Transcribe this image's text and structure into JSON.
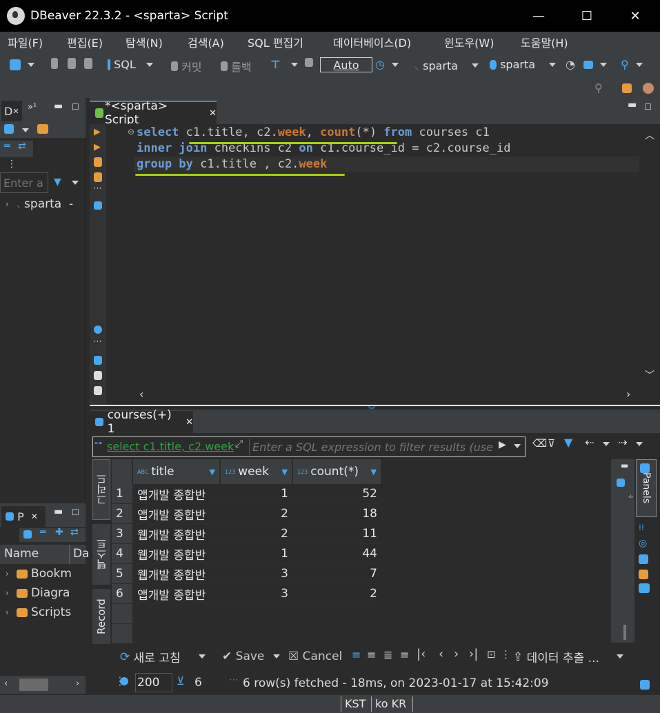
{
  "window": {
    "title": "DBeaver 22.3.2 - <sparta> Script",
    "minimize": "—",
    "maximize": "☐",
    "close": "✕"
  },
  "menu": [
    "파일(F)",
    "편집(E)",
    "탐색(N)",
    "검색(A)",
    "SQL 편집기",
    "데이터베이스(D)",
    "윈도우(W)",
    "도움말(H)"
  ],
  "toolbar": {
    "sql_label": "SQL",
    "commit_label": "커밋",
    "rollback_label": "롤백",
    "transaction_mode": "Auto",
    "datasource": "sparta",
    "schema": "sparta"
  },
  "left_panel": {
    "tab_label": "D",
    "filter_placeholder": "Enter a",
    "tree_item": "sparta",
    "tree_item_suffix": "-"
  },
  "projects_panel": {
    "tab_label": "P",
    "column_name": "Name",
    "column_da": "Da",
    "items": [
      "Bookm",
      "Diagra",
      "Scripts"
    ]
  },
  "editor": {
    "tab_label": "*<sparta> Script",
    "lines": [
      {
        "parts": [
          [
            "kw",
            "select"
          ],
          [
            "",
            ""
          ],
          [
            "",
            " c1.title, c2."
          ],
          [
            "kwb",
            "week"
          ],
          [
            "",
            ", "
          ],
          [
            "kwb",
            "count"
          ],
          [
            "",
            "(*) "
          ],
          [
            "kw",
            "from"
          ],
          [
            "",
            " courses c1"
          ]
        ]
      },
      {
        "parts": [
          [
            "kw",
            "inner join"
          ],
          [
            "",
            " checkins c2 "
          ],
          [
            "kw",
            "on"
          ],
          [
            "",
            " c1.course_id = c2.course_id"
          ]
        ]
      },
      {
        "parts": [
          [
            "kw",
            "group by"
          ],
          [
            "",
            " c1.title , c2."
          ],
          [
            "kwb",
            "week"
          ]
        ]
      }
    ]
  },
  "results": {
    "tab_label": "courses(+) 1",
    "query_preview": "select c1.title, c2.week",
    "filter_placeholder": "Enter a SQL expression to filter results (use",
    "side_tabs": {
      "grid": "그리드",
      "text": "텍스트",
      "record": "Record"
    },
    "columns": [
      {
        "type": "ABC",
        "label": "title"
      },
      {
        "type": "123",
        "label": "week"
      },
      {
        "type": "123",
        "label": "count(*)"
      }
    ],
    "rows": [
      [
        "1",
        "앱개발 종합반",
        "1",
        "52"
      ],
      [
        "2",
        "앱개발 종합반",
        "2",
        "18"
      ],
      [
        "3",
        "웹개발 종합반",
        "2",
        "11"
      ],
      [
        "4",
        "웹개발 종합반",
        "1",
        "44"
      ],
      [
        "5",
        "웹개발 종합반",
        "3",
        "7"
      ],
      [
        "6",
        "앱개발 종합반",
        "3",
        "2"
      ]
    ],
    "panels_label": "Panels",
    "refresh_label": "새로 고침",
    "save_label": "Save",
    "cancel_label": "Cancel",
    "export_label": "데이터 추출 ...",
    "fetch_size": "200",
    "row_count": "6",
    "status_message": "6 row(s) fetched - 18ms, on 2023-01-17 at 15:42:09"
  },
  "statusbar": {
    "timezone": "KST",
    "locale": "ko KR"
  }
}
